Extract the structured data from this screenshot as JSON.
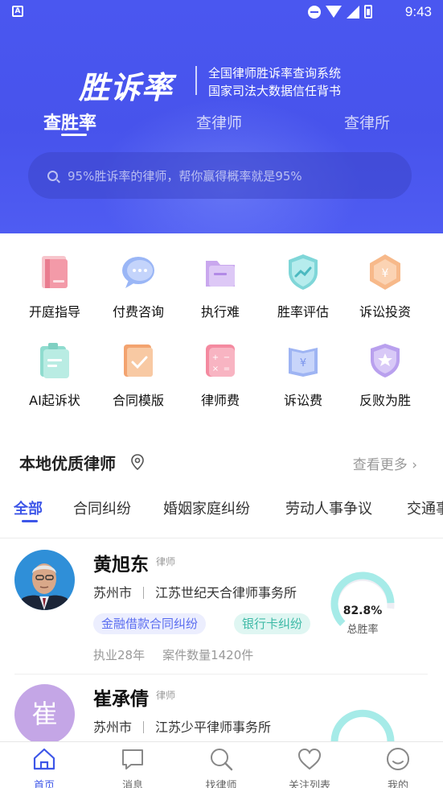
{
  "status_bar": {
    "time": "9:43",
    "app_icon": "A"
  },
  "header": {
    "brand": "胜诉率",
    "tagline_line1": "全国律师胜诉率查询系统",
    "tagline_line2": "国家司法大数据信任背书",
    "tabs": [
      {
        "label": "查胜率",
        "active": true
      },
      {
        "label": "查律师",
        "active": false
      },
      {
        "label": "查律所",
        "active": false
      }
    ],
    "search_placeholder": "95%胜诉率的律师，帮你赢得概率就是95%"
  },
  "features": [
    {
      "label": "开庭指导",
      "icon": "document-book-icon"
    },
    {
      "label": "付费咨询",
      "icon": "chat-bubble-icon"
    },
    {
      "label": "执行难",
      "icon": "folder-icon"
    },
    {
      "label": "胜率评估",
      "icon": "shield-chart-icon"
    },
    {
      "label": "诉讼投资",
      "icon": "yuan-hexagon-icon"
    },
    {
      "label": "AI起诉状",
      "icon": "clipboard-icon"
    },
    {
      "label": "合同模版",
      "icon": "contract-check-icon"
    },
    {
      "label": "律师费",
      "icon": "calculator-icon"
    },
    {
      "label": "诉讼费",
      "icon": "yuan-book-icon"
    },
    {
      "label": "反败为胜",
      "icon": "star-shield-icon"
    }
  ],
  "section": {
    "title": "本地优质律师",
    "more": "查看更多",
    "categories": [
      "全部",
      "合同纠纷",
      "婚姻家庭纠纷",
      "劳动人事争议",
      "交通事"
    ]
  },
  "lawyers": [
    {
      "name": "黄旭东",
      "role": "律师",
      "city": "苏州市",
      "firm": "江苏世纪天合律师事务所",
      "tags": [
        "金融借款合同纠纷",
        "银行卡纠纷"
      ],
      "years": "执业28年",
      "cases": "案件数量1420件",
      "win_rate": "82.8%",
      "win_rate_value": 82.8,
      "win_caption": "总胜率",
      "avatar": "photo"
    },
    {
      "name": "崔承倩",
      "role": "律师",
      "city": "苏州市",
      "firm": "江苏少平律师事务所",
      "avatar_char": "崔"
    }
  ],
  "bottom_nav": [
    {
      "label": "首页",
      "icon": "home-icon",
      "active": true
    },
    {
      "label": "消息",
      "icon": "message-icon",
      "active": false
    },
    {
      "label": "找律师",
      "icon": "search-icon",
      "active": false
    },
    {
      "label": "关注列表",
      "icon": "heart-icon",
      "active": false
    },
    {
      "label": "我的",
      "icon": "profile-icon",
      "active": false
    }
  ],
  "colors": {
    "primary": "#4a57f0",
    "accent": "#3d56e8",
    "gauge": "#a6ebe8"
  }
}
